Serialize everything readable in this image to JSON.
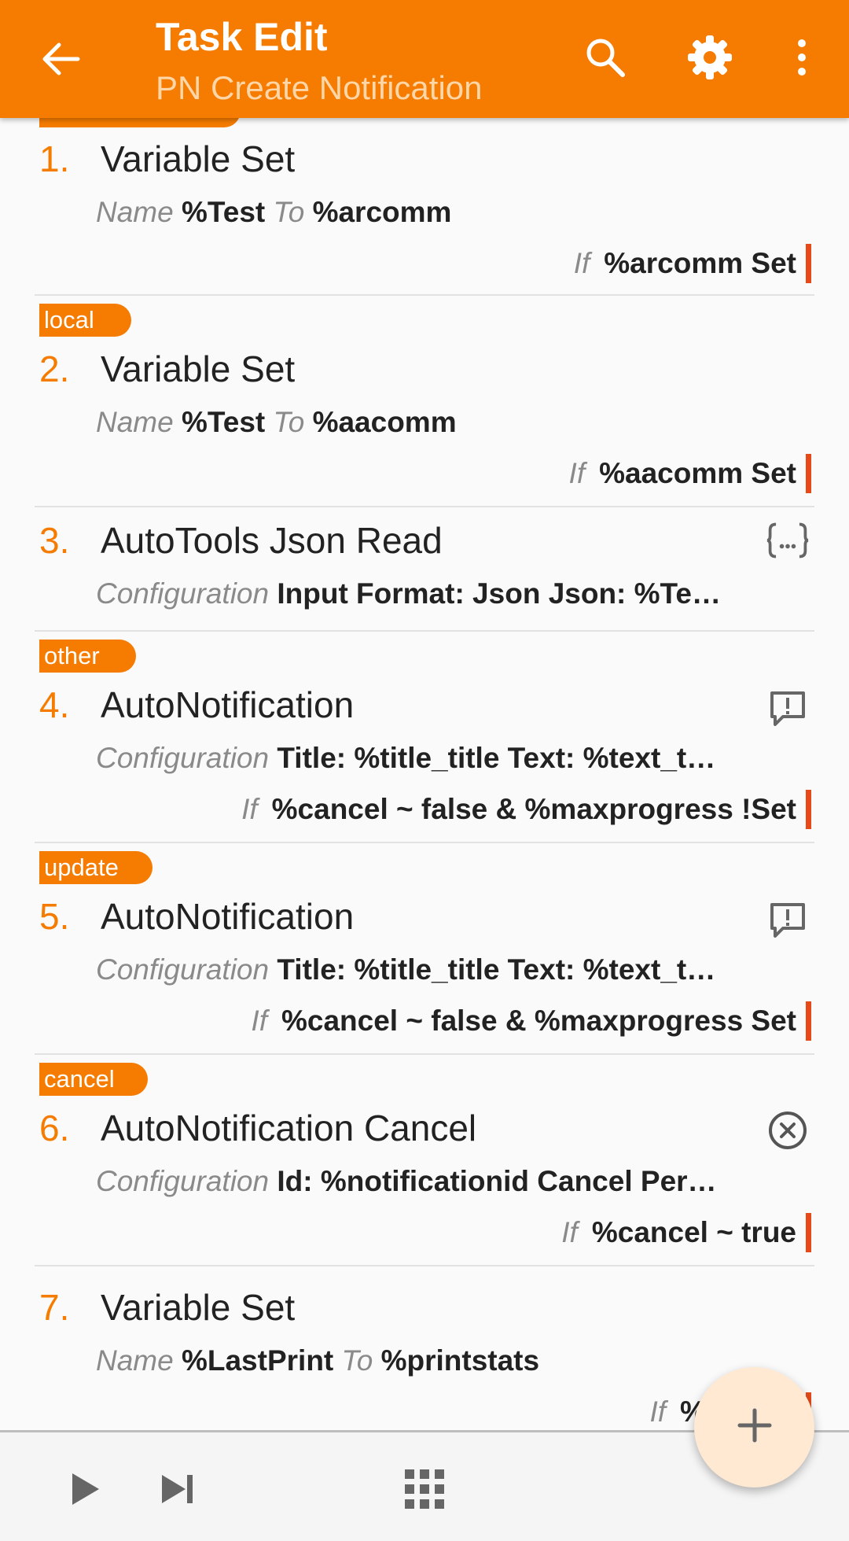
{
  "appbar": {
    "title": "Task Edit",
    "subtitle": "PN Create Notification",
    "icons": [
      "back-arrow-icon",
      "search-icon",
      "gear-icon",
      "more-vert-icon"
    ]
  },
  "actions": [
    {
      "label": "",
      "number": "1.",
      "name": "Variable Set",
      "arg_key": "Name",
      "arg_value": "%Test",
      "arg_key2": "To",
      "arg_value2": "%arcomm",
      "if_key": "If",
      "if_value": "%arcomm Set"
    },
    {
      "label": "local",
      "number": "2.",
      "name": "Variable Set",
      "arg_key": "Name",
      "arg_value": "%Test",
      "arg_key2": "To",
      "arg_value2": "%aacomm",
      "if_key": "If",
      "if_value": "%aacomm Set"
    },
    {
      "label": "",
      "number": "3.",
      "name": "AutoTools Json Read",
      "arg_key": "Configuration",
      "arg_value": "Input Format: Json Json: %Te…",
      "icon": "json-braces-icon"
    },
    {
      "label": "other",
      "number": "4.",
      "name": "AutoNotification",
      "arg_key": "Configuration",
      "arg_value": "Title: %title_title Text: %text_t…",
      "if_key": "If",
      "if_value": "%cancel ~ false & %maxprogress !Set",
      "icon": "notification-alert-icon"
    },
    {
      "label": "update",
      "number": "5.",
      "name": "AutoNotification",
      "arg_key": "Configuration",
      "arg_value": "Title: %title_title Text: %text_t…",
      "if_key": "If",
      "if_value": "%cancel ~ false & %maxprogress Set",
      "icon": "notification-alert-icon"
    },
    {
      "label": "cancel",
      "number": "6.",
      "name": "AutoNotification Cancel",
      "arg_key": "Configuration",
      "arg_value": "Id: %notificationid Cancel Per…",
      "if_key": "If",
      "if_value": "%cancel ~ true",
      "icon": "cancel-circle-icon"
    },
    {
      "label": "",
      "number": "7.",
      "name": "Variable Set",
      "arg_key": "Name",
      "arg_value": "%LastPrint",
      "arg_key2": "To",
      "arg_value2": "%printstats",
      "if_key": "If",
      "if_value": "%printst"
    }
  ],
  "bottombar": {
    "icons": [
      "play-icon",
      "skip-next-icon",
      "grid-apps-icon"
    ]
  },
  "fab": {
    "icon": "add-icon"
  },
  "colors": {
    "accent": "#f57c00",
    "condition_bar": "#e64a19",
    "fab_bg": "#ffe9d2",
    "subtitle": "#ffd6a8"
  }
}
